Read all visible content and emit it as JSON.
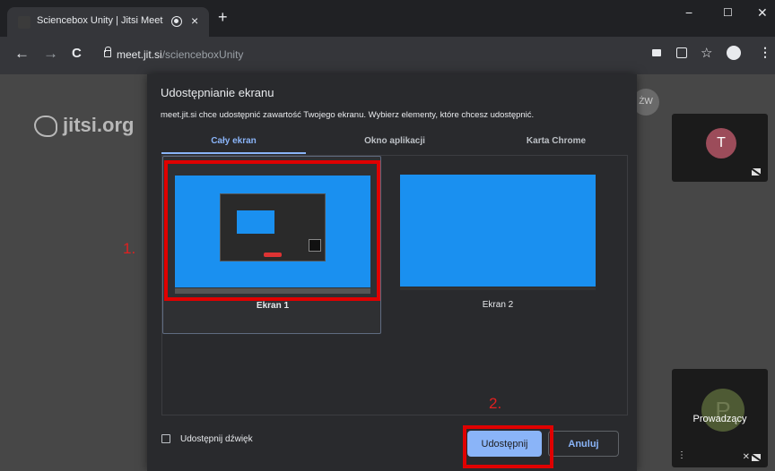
{
  "browser": {
    "tab_title": "Sciencebox Unity | Jitsi Meet",
    "new_tab": "+",
    "close_tab": "×",
    "window_controls": {
      "minimize": "−",
      "maximize": "☐",
      "close": "✕"
    },
    "nav": {
      "back": "←",
      "forward": "→",
      "reload": "C"
    },
    "url_host": "meet.jit.si",
    "url_path": "/scienceboxUnity",
    "toolbar_icons": [
      "camera-icon",
      "translate-icon",
      "star-icon",
      "profile-icon",
      "menu-icon"
    ]
  },
  "page": {
    "logo_text": "jitsi.org",
    "participant_badge": "ŻW",
    "thumb_top_initial": "T",
    "thumb_bottom_initial": "P",
    "thumb_bottom_name": "Prowadzący",
    "thumb_menu": "⋮"
  },
  "dialog": {
    "title": "Udostępnianie ekranu",
    "subtitle": "meet.jit.si chce udostępnić zawartość Twojego ekranu. Wybierz elementy, które chcesz udostępnić.",
    "tabs": [
      {
        "label": "Cały ekran",
        "active": true
      },
      {
        "label": "Okno aplikacji",
        "active": false
      },
      {
        "label": "Karta Chrome",
        "active": false
      }
    ],
    "screens": [
      {
        "label": "Ekran 1",
        "selected": true
      },
      {
        "label": "Ekran 2",
        "selected": false
      }
    ],
    "audio_checkbox_label": "Udostępnij dźwięk",
    "audio_checked": false,
    "share_button": "Udostępnij",
    "cancel_button": "Anuluj"
  },
  "annotations": {
    "step1": "1.",
    "step2": "2.",
    "highlight_color": "#e00000"
  },
  "colors": {
    "accent": "#8ab4f8",
    "preview_blue": "#1a90f0",
    "dialog_bg": "#292a2d"
  }
}
